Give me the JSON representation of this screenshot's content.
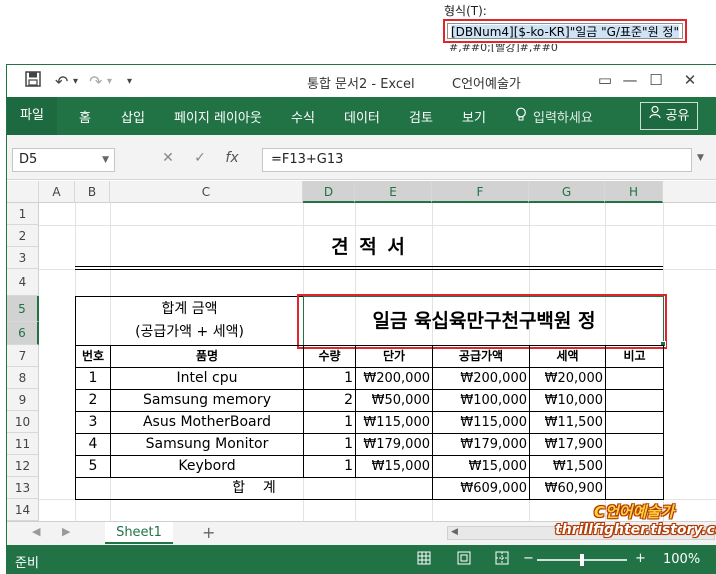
{
  "format_dialog": {
    "label": "형식(T):",
    "value": "[DBNum4][$-ko-KR]\"일금 \"G/표준\"원 정\"",
    "partial_text": "#,##0;[빨강]#,##0"
  },
  "window": {
    "doc_title": "통합 문서2  -  Excel",
    "user": "C언어예술가",
    "quick_access": {
      "save": "save-icon",
      "undo": "↶",
      "redo": "↷",
      "more": "▾"
    },
    "controls": {
      "ribbon_display": "▭",
      "minimize": "—",
      "maximize": "☐",
      "close": "✕"
    }
  },
  "ribbon": {
    "tabs": [
      "파일",
      "홈",
      "삽입",
      "페이지 레이아웃",
      "수식",
      "데이터",
      "검토",
      "보기"
    ],
    "tell_me": "입력하세요",
    "share": "공유"
  },
  "formula_bar": {
    "name_box": "D5",
    "cancel": "✕",
    "enter": "✓",
    "fx": "fx",
    "formula": "=F13+G13"
  },
  "columns": [
    "A",
    "B",
    "C",
    "D",
    "E",
    "F",
    "G",
    "H"
  ],
  "rows": [
    "1",
    "2",
    "3",
    "4",
    "5",
    "6",
    "7",
    "8",
    "9",
    "10",
    "11",
    "12",
    "13",
    "14"
  ],
  "sheet": {
    "title": "견 적 서",
    "total_label_1": "합계 금액",
    "total_label_2": "(공급가액 + 세액)",
    "total_amount_text": "일금 육십육만구천구백원 정",
    "headers": [
      "번호",
      "품명",
      "수량",
      "단가",
      "공급가액",
      "세액",
      "비고"
    ],
    "items": [
      {
        "no": "1",
        "name": "Intel cpu",
        "qty": "1",
        "price": "₩200,000",
        "supply": "₩200,000",
        "tax": "₩20,000",
        "note": ""
      },
      {
        "no": "2",
        "name": "Samsung memory",
        "qty": "2",
        "price": "₩50,000",
        "supply": "₩100,000",
        "tax": "₩10,000",
        "note": ""
      },
      {
        "no": "3",
        "name": "Asus MotherBoard",
        "qty": "1",
        "price": "₩115,000",
        "supply": "₩115,000",
        "tax": "₩11,500",
        "note": ""
      },
      {
        "no": "4",
        "name": "Samsung Monitor",
        "qty": "1",
        "price": "₩179,000",
        "supply": "₩179,000",
        "tax": "₩17,900",
        "note": ""
      },
      {
        "no": "5",
        "name": "Keybord",
        "qty": "1",
        "price": "₩15,000",
        "supply": "₩15,000",
        "tax": "₩1,500",
        "note": ""
      }
    ],
    "sum_label": "합    계",
    "sum_supply": "₩609,000",
    "sum_tax": "₩60,900"
  },
  "tabs": {
    "sheet1": "Sheet1",
    "add": "+",
    "prev": "◀",
    "next": "▶",
    "scroll_left": "◀"
  },
  "status": {
    "ready": "준비",
    "zoom": "100%",
    "zoom_minus": "−",
    "zoom_plus": "+",
    "zoom_level": 1.0
  },
  "watermark": {
    "line1": "C언어예술가",
    "line2": "thrillfighter.tistory.com"
  },
  "colors": {
    "excel_green": "#217346",
    "highlight_red": "#e0262b",
    "selection_green": "#217346"
  }
}
